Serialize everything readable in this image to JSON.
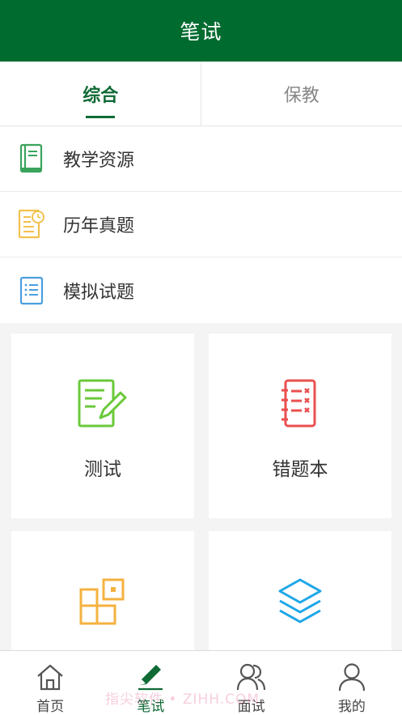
{
  "header": {
    "title": "笔试"
  },
  "tabs": [
    {
      "label": "综合",
      "active": true
    },
    {
      "label": "保教",
      "active": false
    }
  ],
  "list": [
    {
      "label": "教学资源",
      "icon": "book-icon",
      "color": "#3aa35c"
    },
    {
      "label": "历年真题",
      "icon": "document-clock-icon",
      "color": "#f2c14e"
    },
    {
      "label": "模拟试题",
      "icon": "list-icon",
      "color": "#4a9fe0"
    }
  ],
  "cards": [
    {
      "label": "测试",
      "icon": "edit-document-icon",
      "color": "#6ac93a"
    },
    {
      "label": "错题本",
      "icon": "wrong-notebook-icon",
      "color": "#e9504f"
    },
    {
      "label": "",
      "icon": "blocks-icon",
      "color": "#f5b240"
    },
    {
      "label": "",
      "icon": "layers-icon",
      "color": "#1ea7e8"
    }
  ],
  "bottom_nav": [
    {
      "label": "首页",
      "icon": "home-icon",
      "active": false
    },
    {
      "label": "笔试",
      "icon": "pen-icon",
      "active": true
    },
    {
      "label": "面试",
      "icon": "people-icon",
      "active": false
    },
    {
      "label": "我的",
      "icon": "person-icon",
      "active": false
    }
  ],
  "watermark": "指尖软件 • ZIHH.COM",
  "colors": {
    "brand": "#006b2f",
    "accent": "#0f6a35"
  }
}
